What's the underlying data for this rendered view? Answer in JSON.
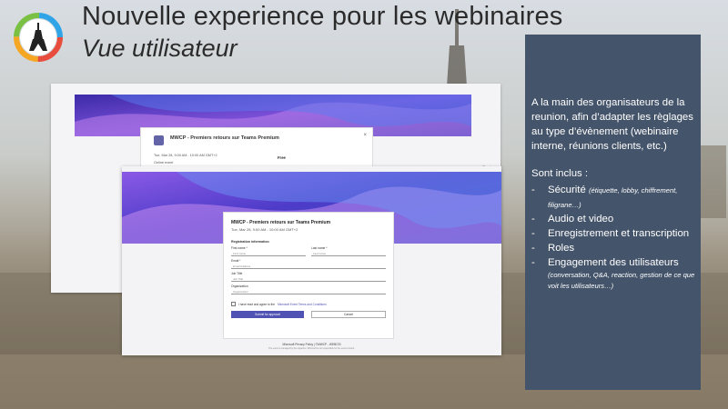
{
  "slide": {
    "title": "Nouvelle experience pour les webinaires",
    "subtitle": "Vue utilisateur"
  },
  "panel": {
    "intro": "A la main des organisateurs de la reunion, afin d’adapter les règlages au type d’évènement (webinaire interne, réunions clients, etc.)",
    "lead": "Sont inclus :",
    "items": [
      {
        "label": "Sécurité",
        "note": "(étiquette, lobby, chiffrement, filigrane…)"
      },
      {
        "label": "Audio et video",
        "note": ""
      },
      {
        "label": "Enregistrement et transcription",
        "note": ""
      },
      {
        "label": "Roles",
        "note": ""
      },
      {
        "label": "Engagement des utilisateurs",
        "note": "(conversation, Q&A, reaction, gestion de ce que voit les utilisateurs…)"
      }
    ],
    "dash": "-"
  },
  "screenshot": {
    "back": {
      "event_title": "MWCP - Premiers retours sur Teams Premium",
      "date": "Tue, Mar 28, 9:00 AM - 10:00 AM GMT+2",
      "address": "Online event",
      "price": "Free",
      "close_glyph": "×",
      "sign_in": "Sign in"
    },
    "front": {
      "event_title": "MWCP - Premiers retours sur Teams Premium",
      "date": "Tue, Mar 28, 9:00 AM - 10:00 AM GMT+2",
      "section": "Registration information",
      "first_name_label": "First name *",
      "first_name_placeholder": "First name",
      "last_name_label": "Last name *",
      "last_name_placeholder": "Last name",
      "email_label": "Email *",
      "email_placeholder": "Email Address",
      "job_label": "Job Title",
      "job_placeholder": "Job Title",
      "org_label": "Organization",
      "org_placeholder": "Organization",
      "terms_prefix": "I have read and agree to the ",
      "terms_link": "Microsoft Event Terms and Conditions",
      "submit": "Submit for approval",
      "cancel": "Cancel",
      "footer": "Microsoft Privacy Policy  |  ©MWCP - WEBCSI",
      "footer_small": "The event is managed by the organizer. Microsoft is not responsible for the event content."
    }
  },
  "colors": {
    "panel_bg": "#44546a",
    "accent": "#4f52b2",
    "logo_ring": [
      "#e84c3d",
      "#f5a623",
      "#7ac143",
      "#2fa4e7"
    ]
  }
}
